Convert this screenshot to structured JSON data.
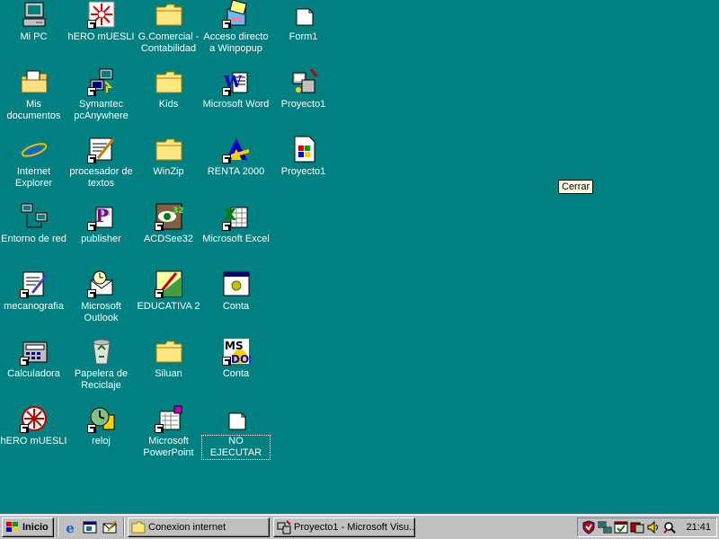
{
  "desktop": {
    "icons": [
      {
        "label": "Mi PC",
        "icon": "my-computer-icon"
      },
      {
        "label": "hERO mUESLI",
        "icon": "hero-muesli-icon"
      },
      {
        "label": "G.Comercial - Contabilidad",
        "icon": "folder-icon"
      },
      {
        "label": "Acceso directo a Winpopup",
        "icon": "winpopup-icon"
      },
      {
        "label": "Form1",
        "icon": "blank-document-icon"
      },
      {
        "label": "Mis documentos",
        "icon": "my-documents-icon"
      },
      {
        "label": "Symantec pcAnywhere",
        "icon": "pcanywhere-icon"
      },
      {
        "label": "Kids",
        "icon": "folder-icon"
      },
      {
        "label": "Microsoft Word",
        "icon": "word-icon"
      },
      {
        "label": "Proyecto1",
        "icon": "vb-project-icon"
      },
      {
        "label": "Internet Explorer",
        "icon": "internet-explorer-icon"
      },
      {
        "label": "procesador de textos",
        "icon": "text-processor-icon"
      },
      {
        "label": "WinZip",
        "icon": "folder-icon"
      },
      {
        "label": "RENTA 2000",
        "icon": "renta-icon"
      },
      {
        "label": "Proyecto1",
        "icon": "vb-exe-icon"
      },
      {
        "label": "Entorno de red",
        "icon": "network-icon"
      },
      {
        "label": "publisher",
        "icon": "publisher-icon"
      },
      {
        "label": "ACDSee32",
        "icon": "acdsee-icon"
      },
      {
        "label": "Microsoft Excel",
        "icon": "excel-icon"
      },
      {
        "label": "mecanografia",
        "icon": "mecanografia-icon"
      },
      {
        "label": "Microsoft Outlook",
        "icon": "outlook-icon"
      },
      {
        "label": "EDUCATIVA 2",
        "icon": "educativa-icon"
      },
      {
        "label": "Conta",
        "icon": "conta-window-icon"
      },
      {
        "label": "Calculadora",
        "icon": "calculator-icon"
      },
      {
        "label": "Papelera de Reciclaje",
        "icon": "recycle-bin-icon"
      },
      {
        "label": "Siluan",
        "icon": "folder-icon"
      },
      {
        "label": "Conta",
        "icon": "msdos-icon"
      },
      {
        "label": "hERO mUESLI",
        "icon": "hero-muesli-icon"
      },
      {
        "label": "reloj",
        "icon": "clock-app-icon"
      },
      {
        "label": "Microsoft PowerPoint",
        "icon": "powerpoint-icon"
      },
      {
        "label": "NO EJECUTAR",
        "icon": "blank-document-icon"
      }
    ]
  },
  "tooltip": {
    "text": "Cerrar"
  },
  "taskbar": {
    "start_label": "Inicio",
    "quick_launch": [
      "internet-explorer-icon",
      "show-desktop-icon",
      "outlook-express-icon"
    ],
    "tasks": [
      {
        "label": "Conexion internet",
        "icon": "folder-icon"
      },
      {
        "label": "Proyecto1 - Microsoft Visu...",
        "icon": "vb-project-icon"
      }
    ],
    "tray_icons": [
      "antivirus-icon",
      "network-tray-icon",
      "scheduler-icon",
      "vb-tray-icon",
      "volume-icon",
      "search-tray-icon"
    ],
    "clock": "21:41"
  },
  "colors": {
    "desktop": "#008080",
    "taskbar": "#c0c0c0",
    "tooltip_bg": "#ffffe1"
  }
}
